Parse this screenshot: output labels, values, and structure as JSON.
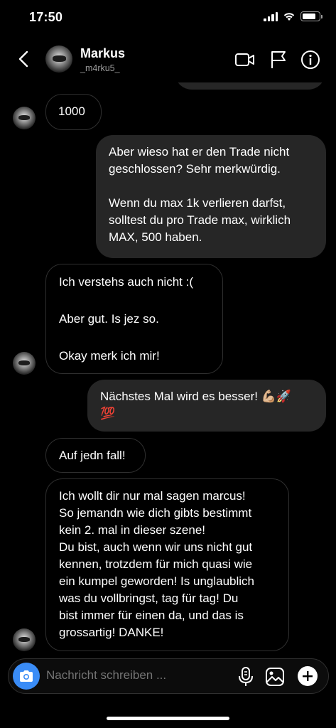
{
  "status_bar": {
    "time": "17:50",
    "battery_level": 0.8
  },
  "header": {
    "name": "Markus",
    "handle": "_m4rku5_",
    "icons": [
      "back-chevron-icon",
      "video-call-icon",
      "flag-icon",
      "info-icon"
    ]
  },
  "messages": [
    {
      "from": "them",
      "lines": [
        "1000"
      ]
    },
    {
      "from": "me",
      "lines": [
        "Aber wieso hat er den Trade nicht",
        "geschlossen? Sehr merkwürdig.",
        "",
        "Wenn du max 1k verlieren darfst,",
        "solltest du pro Trade max, wirklich",
        "MAX, 500 haben."
      ]
    },
    {
      "from": "them",
      "lines": [
        "Ich verstehs auch nicht :(",
        "",
        "Aber gut. Is jez so.",
        "",
        "Okay merk ich mir!"
      ]
    },
    {
      "from": "me",
      "lines": [
        "Nächstes Mal wird es besser! 💪🏼🚀",
        "💯"
      ]
    },
    {
      "from": "them",
      "lines": [
        "Auf jedn fall!"
      ]
    },
    {
      "from": "them",
      "lines": [
        "Ich wollt dir nur mal sagen marcus!",
        "So jemandn wie dich gibts bestimmt",
        "kein 2. mal in dieser szene!",
        "Du bist, auch wenn wir uns nicht gut",
        "kennen, trotzdem für mich quasi wie",
        "ein kumpel geworden! Is unglaublich",
        "was du vollbringst, tag für tag! Du",
        "bist immer für einen da, und das is",
        "grossartig! DANKE!"
      ]
    }
  ],
  "composer": {
    "placeholder": "Nachricht schreiben ..."
  },
  "colors": {
    "accent": "#3a8cf6",
    "outgoing_bubble": "#262626",
    "incoming_border": "#2f2f2f"
  }
}
